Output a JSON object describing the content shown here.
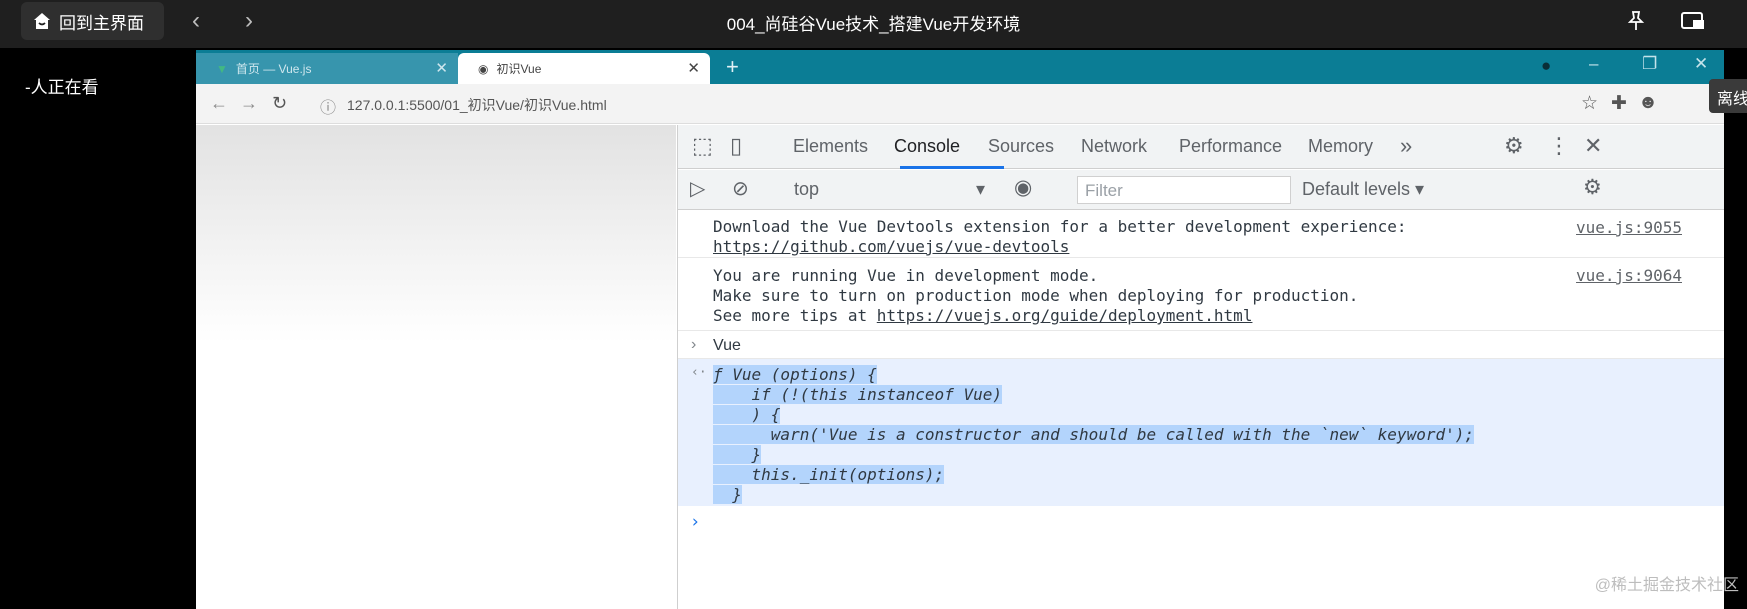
{
  "player": {
    "home_label": "回到主界面",
    "title": "004_尚硅谷Vue技术_搭建Vue开发环境",
    "viewers": "-人正在看",
    "side_tip": "离线",
    "watermark": "@稀土掘金技术社区"
  },
  "browser": {
    "tabs": [
      {
        "label": "首页 — Vue.js"
      },
      {
        "label": "初识Vue"
      }
    ],
    "url": "127.0.0.1:5500/01_初识Vue/初识Vue.html"
  },
  "devtools": {
    "tabs": [
      "Elements",
      "Console",
      "Sources",
      "Network",
      "Performance",
      "Memory"
    ],
    "active_tab": "Console",
    "context": "top",
    "filter_placeholder": "Filter",
    "levels": "Default levels ▾",
    "messages": [
      {
        "lines": [
          "Download the Vue Devtools extension for a better development experience:"
        ],
        "link": "https://github.com/vuejs/vue-devtools",
        "source": "vue.js:9055"
      },
      {
        "lines": [
          "You are running Vue in development mode.",
          "Make sure to turn on production mode when deploying for production."
        ],
        "link_prefix": "See more tips at ",
        "link": "https://vuejs.org/guide/deployment.html",
        "source": "vue.js:9064"
      }
    ],
    "input": "Vue",
    "result": [
      "ƒ Vue (options) {",
      "    if (!(this instanceof Vue)",
      "    ) {",
      "      warn('Vue is a constructor and should be called with the `new` keyword');",
      "    }",
      "    this._init(options);",
      "  }"
    ]
  }
}
